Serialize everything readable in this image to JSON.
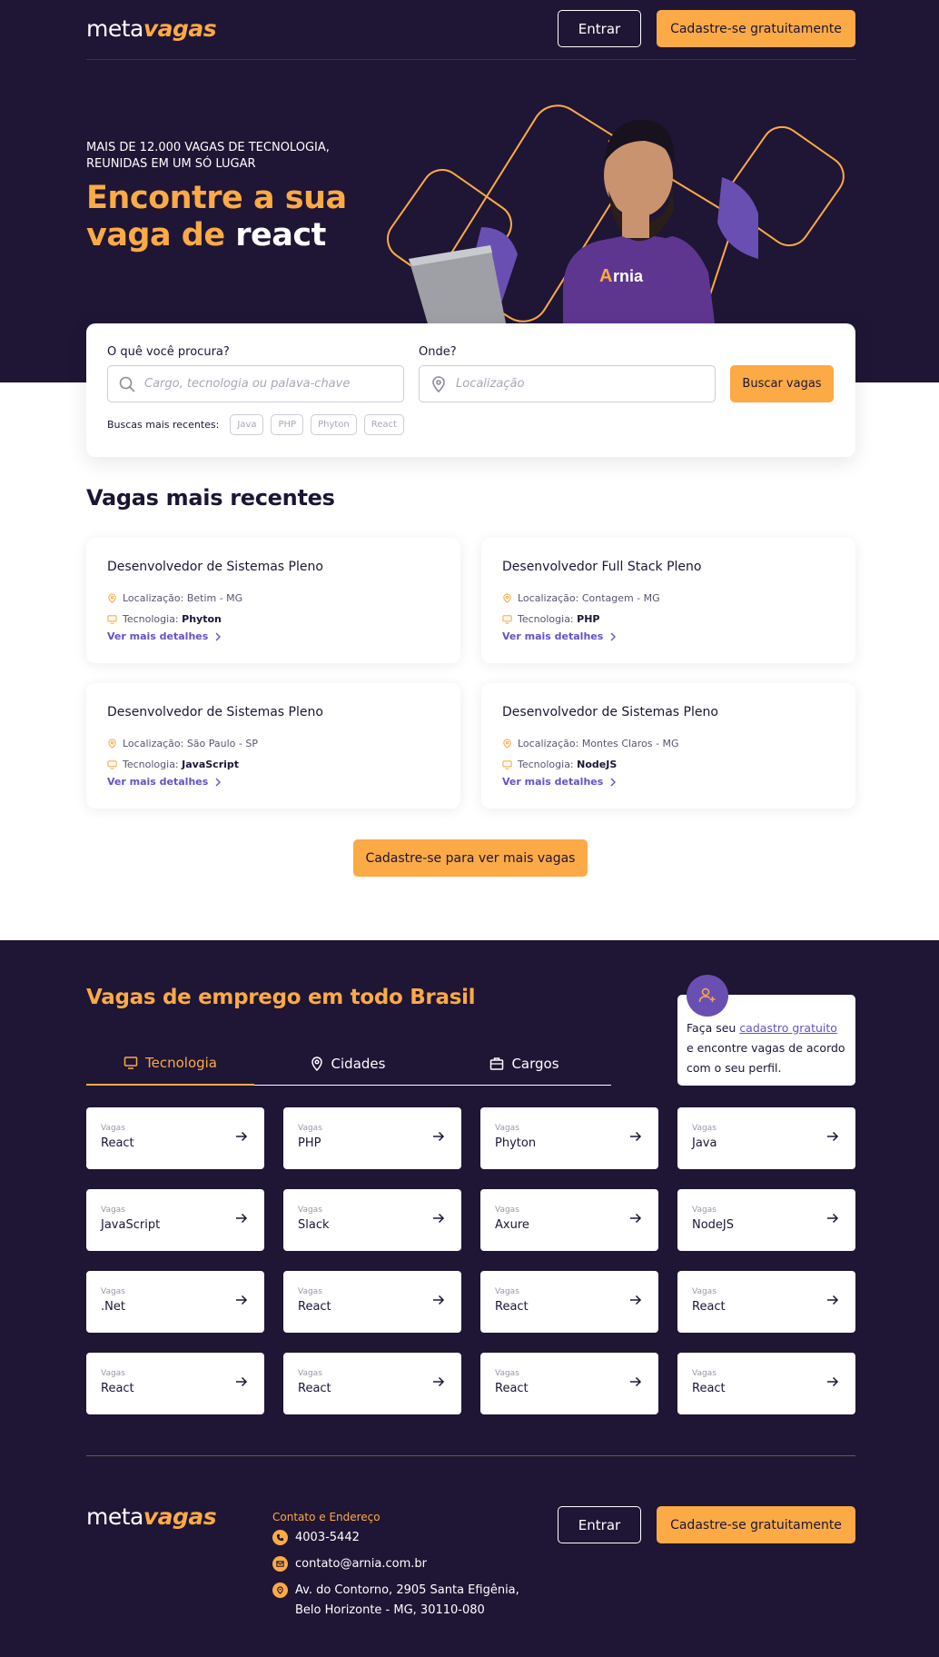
{
  "header": {
    "logo_meta": "meta",
    "logo_vagas": "vagas",
    "login_label": "Entrar",
    "signup_label": "Cadastre-se gratuitamente"
  },
  "hero": {
    "subtitle_line1": "MAIS DE 12.000 VAGAS DE TECNOLOGIA,",
    "subtitle_line2": "REUNIDAS EM UM SÓ LUGAR",
    "title_part1": "Encontre a sua",
    "title_part2": "vaga de ",
    "title_highlight": "react"
  },
  "search": {
    "what_label": "O quê você procura?",
    "what_placeholder": "Cargo, tecnologia ou palava-chave",
    "where_label": "Onde?",
    "where_placeholder": "Localização",
    "button_label": "Buscar vagas",
    "recent_label": "Buscas mais recentes:",
    "recent_chips": [
      "Java",
      "PHP",
      "Phyton",
      "React"
    ]
  },
  "recent_jobs": {
    "title": "Vagas mais recentes",
    "location_prefix": "Localização: ",
    "tech_prefix": "Tecnologia: ",
    "details_label": "Ver mais detalhes",
    "jobs": [
      {
        "title": "Desenvolvedor de Sistemas Pleno",
        "location": "Betim - MG",
        "tech": "Phyton"
      },
      {
        "title": "Desenvolvedor Full Stack Pleno",
        "location": "Contagem  - MG",
        "tech": "PHP"
      },
      {
        "title": "Desenvolvedor de Sistemas Pleno",
        "location": "São Paulo - SP",
        "tech": "JavaScript"
      },
      {
        "title": "Desenvolvedor de Sistemas Pleno",
        "location": "Montes Claros  - MG",
        "tech": "NodeJS"
      }
    ],
    "more_button": "Cadastre-se para ver mais vagas"
  },
  "brazil": {
    "title": "Vagas de emprego em todo Brasil",
    "tabs": [
      {
        "label": "Tecnologia",
        "icon": "monitor-icon",
        "active": true
      },
      {
        "label": "Cidades",
        "icon": "map-pin-icon",
        "active": false
      },
      {
        "label": "Cargos",
        "icon": "briefcase-icon",
        "active": false
      }
    ],
    "promo": {
      "text_before": "Faça seu ",
      "link": "cadastro gratuito",
      "text_after": " e encontre vagas de acordo com o seu perfil.",
      "icon": "add-user-icon"
    },
    "tile_caption": "Vagas",
    "tiles": [
      "React",
      "PHP",
      "Phyton",
      "Java",
      "JavaScript",
      "Slack",
      "Axure",
      "NodeJS",
      ".Net",
      "React",
      "React",
      "React",
      "React",
      "React",
      "React",
      "React"
    ]
  },
  "footer": {
    "logo_meta": "meta",
    "logo_vagas": "vagas",
    "contact_title": "Contato e Endereço",
    "phone": "4003-5442",
    "email": "contato@arnia.com.br",
    "address_line1": "Av. do Contorno, 2905 Santa Efigênia,",
    "address_line2": "Belo Horizonte - MG, 30110-080",
    "login_label": "Entrar",
    "signup_label": "Cadastre-se gratuitamente"
  },
  "colors": {
    "dark": "#1f1535",
    "accent": "#fbaa45",
    "link": "#6353c8",
    "purple": "#6a4fb3"
  }
}
